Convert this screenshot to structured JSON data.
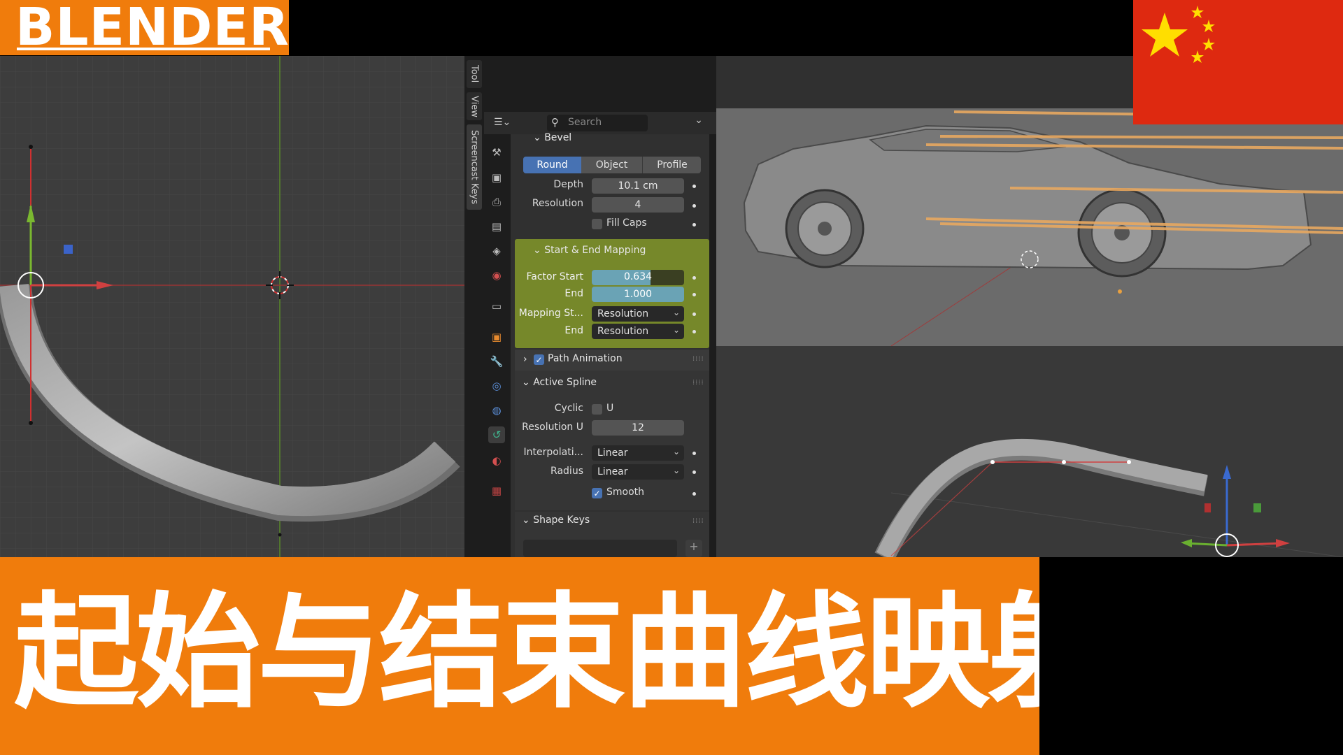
{
  "banner": {
    "logo": "BLENDER",
    "title": "起始与结束曲线映射"
  },
  "ntabs": [
    "Tool",
    "View",
    "Screencast Keys"
  ],
  "header": {
    "search_placeholder": "Search"
  },
  "bevel": {
    "section": "Bevel",
    "modes": [
      "Round",
      "Object",
      "Profile"
    ],
    "active_mode": "Round",
    "depth_label": "Depth",
    "depth_value": "10.1 cm",
    "resolution_label": "Resolution",
    "resolution_value": "4",
    "fill_caps_label": "Fill Caps"
  },
  "mapping": {
    "section": "Start & End Mapping",
    "factor_start_label": "Factor Start",
    "factor_start_value": "0.634",
    "factor_start_fraction": 0.634,
    "end_label": "End",
    "end_value": "1.000",
    "mapping_start_label": "Mapping St...",
    "mapping_start_value": "Resolution",
    "mapping_end_label": "End",
    "mapping_end_value": "Resolution"
  },
  "path_animation": {
    "label": "Path Animation",
    "checked": true
  },
  "active_spline": {
    "section": "Active Spline",
    "cyclic_label": "Cyclic",
    "cyclic_u": "U",
    "resolution_u_label": "Resolution U",
    "resolution_u_value": "12",
    "interpolation_label": "Interpolati...",
    "interpolation_value": "Linear",
    "radius_label": "Radius",
    "radius_value": "Linear",
    "smooth_label": "Smooth"
  },
  "shape_keys": {
    "section": "Shape Keys"
  },
  "colors": {
    "accent": "#f07c0c",
    "mapping_bg": "#7a8c2a",
    "active_blue": "#4772b3",
    "flag_red": "#de2910",
    "flag_star": "#ffde00"
  }
}
